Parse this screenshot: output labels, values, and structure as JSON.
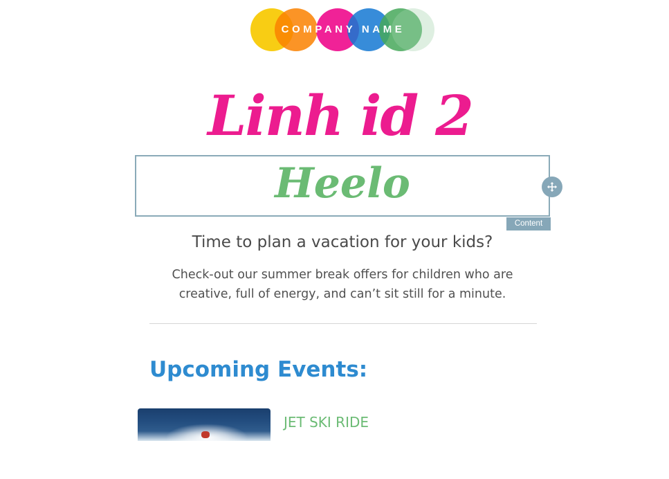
{
  "logo": {
    "text": "COMPANY NAME",
    "colors": [
      "#f7c900",
      "#fa8100",
      "#ee0a8c",
      "#1478d2",
      "#46a85a"
    ]
  },
  "hero": {
    "title": "Linh id 2",
    "title_color": "#ec1c8f",
    "editable_text": "Heelo",
    "editable_color": "#6bbb74",
    "content_tag": "Content",
    "move_icon": "move-arrows-icon"
  },
  "intro": {
    "subtitle": "Time to plan a vacation for your kids?",
    "description": "Check-out our summer break offers for children who are creative, full of energy, and can’t sit still for a minute."
  },
  "events": {
    "heading": "Upcoming Events:",
    "heading_color": "#2e8bd0",
    "items": [
      {
        "title": "JET SKI RIDE",
        "title_color": "#6bbb74"
      }
    ]
  }
}
